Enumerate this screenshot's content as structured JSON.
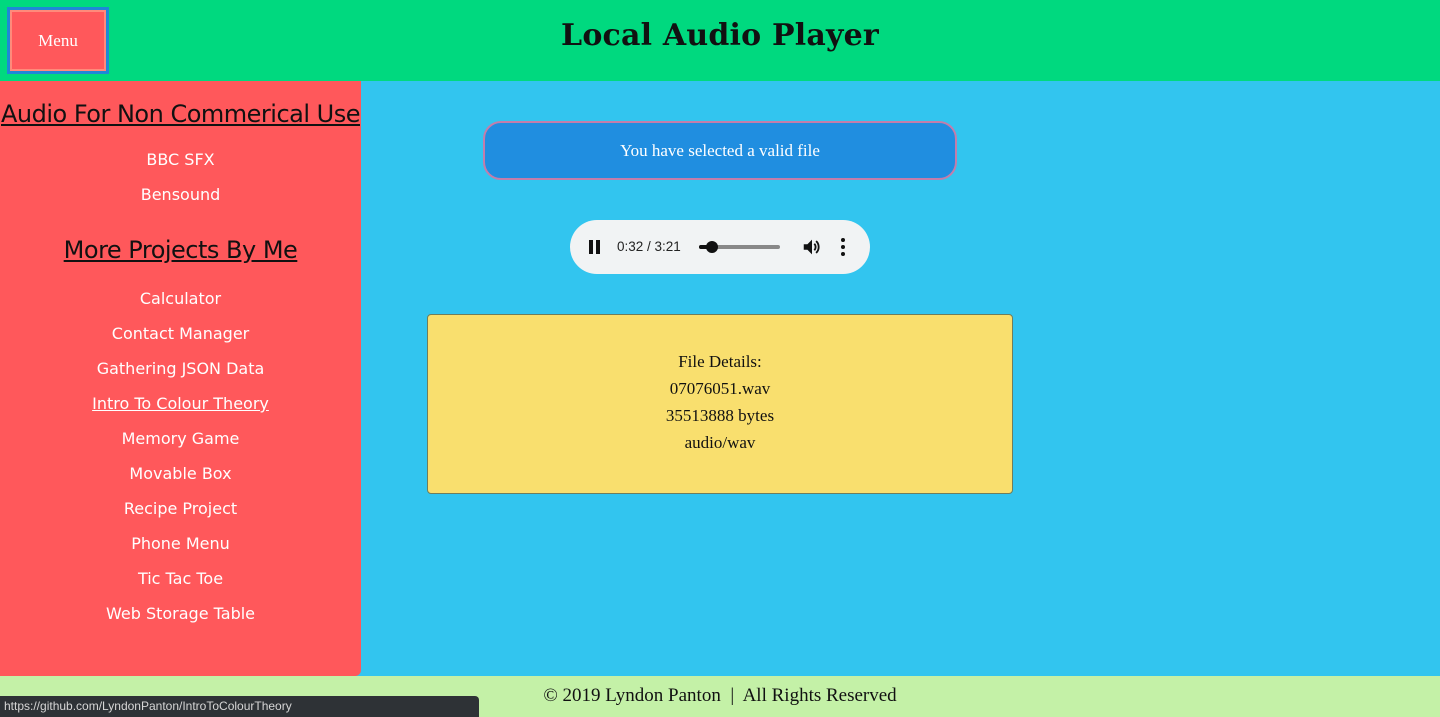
{
  "header": {
    "menu_label": "Menu",
    "title": "Local Audio Player"
  },
  "sidebar": {
    "heading_audio": "Audio For Non Commerical Use",
    "audio_links": [
      "BBC SFX",
      "Bensound"
    ],
    "heading_projects": "More Projects By Me",
    "project_links": [
      "Calculator",
      "Contact Manager",
      "Gathering JSON Data",
      "Intro To Colour Theory",
      "Memory Game",
      "Movable Box",
      "Recipe Project",
      "Phone Menu",
      "Tic Tac Toe",
      "Web Storage Table"
    ],
    "hovered_link": "Intro To Colour Theory"
  },
  "main": {
    "status_message": "You have selected a valid file",
    "player": {
      "time": "0:32 / 3:21",
      "progress": 0.16,
      "state": "playing"
    },
    "details": {
      "heading": "File Details:",
      "filename": "07076051.wav",
      "size": "35513888 bytes",
      "mime": "audio/wav"
    }
  },
  "footer": {
    "text": "© 2019 Lyndon Panton  |  All Rights Reserved"
  },
  "status_bar": {
    "url": "https://github.com/LyndonPanton/IntroToColourTheory"
  },
  "colors": {
    "header_bg": "#00d97f",
    "sidebar_bg": "#ff585b",
    "main_bg": "#32c5ef",
    "banner_bg": "#208ee0",
    "details_bg": "#f9df6e",
    "footer_bg": "#c4f1a7"
  },
  "icons": {
    "play_pause": "pause-icon",
    "volume": "volume-icon",
    "overflow": "more-vertical-icon"
  }
}
